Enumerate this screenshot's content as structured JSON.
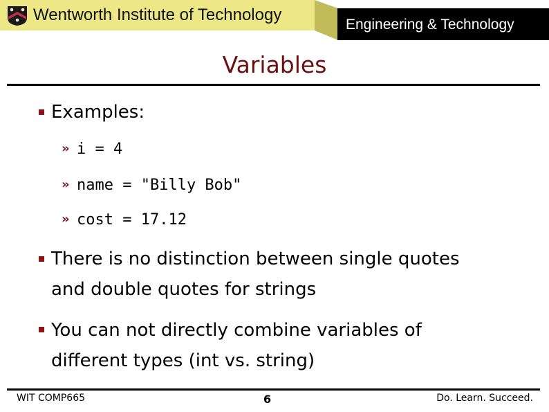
{
  "header": {
    "institution": "Wentworth Institute of Technology",
    "department": "Engineering & Technology",
    "colors": {
      "banner": "#ede787",
      "fold": "#c2bb5a",
      "dept_box": "#000000",
      "title": "#6b0f12",
      "bullet": "#8b1414"
    }
  },
  "slide": {
    "title": "Variables",
    "bullets": [
      {
        "text": "Examples:",
        "sub_items": [
          {
            "marker": "»",
            "code": "i = 4"
          },
          {
            "marker": "»",
            "code": "name = \"Billy Bob\""
          },
          {
            "marker": "»",
            "code": "cost = 17.12"
          }
        ]
      },
      {
        "lines": [
          "There is no distinction between single quotes",
          "and double quotes for strings"
        ]
      },
      {
        "lines": [
          "You can not directly combine variables of",
          "different types (int vs. string)"
        ]
      }
    ]
  },
  "footer": {
    "course": "WIT COMP665",
    "page_number": "6",
    "motto": "Do. Learn. Succeed."
  }
}
